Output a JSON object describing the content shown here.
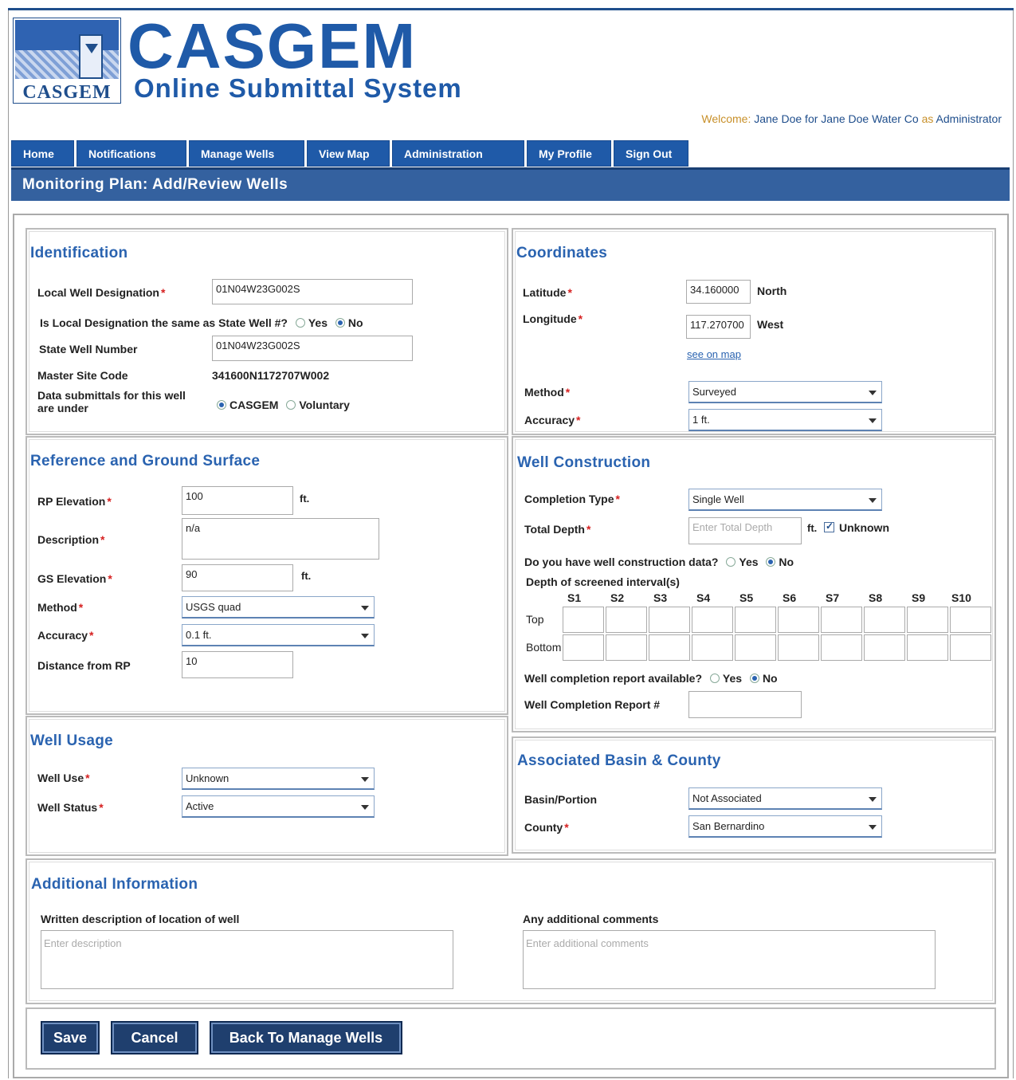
{
  "header": {
    "logo_text": "CASGEM",
    "title": "CASGEM",
    "subtitle": "Online Submittal System",
    "welcome_prefix": "Welcome:",
    "welcome_user": "Jane Doe for Jane Doe Water Co",
    "welcome_as": "as",
    "welcome_role": "Administrator"
  },
  "nav": [
    "Home",
    "Notifications",
    "Manage Wells",
    "View Map",
    "Administration",
    "My Profile",
    "Sign Out"
  ],
  "page_title": "Monitoring Plan: Add/Review Wells",
  "required_mark": "*",
  "identification": {
    "title": "Identification",
    "local_label": "Local Well Designation",
    "local_value": "01N04W23G002S",
    "same_question": "Is Local Designation the same as State Well #?",
    "yes": "Yes",
    "no": "No",
    "state_label": "State Well Number",
    "state_value": "01N04W23G002S",
    "master_label": "Master Site Code",
    "master_value": "341600N1172707W002",
    "submittals_label_1": "Data submittals for this well",
    "submittals_label_2": "are under",
    "opt_casgem": "CASGEM",
    "opt_voluntary": "Voluntary"
  },
  "coordinates": {
    "title": "Coordinates",
    "lat_label": "Latitude",
    "lat_value": "34.160000",
    "lat_dir": "North",
    "lon_label": "Longitude",
    "lon_value": "117.270700",
    "lon_dir": "West",
    "map_link": "see on map",
    "method_label": "Method",
    "method_value": "Surveyed",
    "accuracy_label": "Accuracy",
    "accuracy_value": "1 ft."
  },
  "reference": {
    "title": "Reference and Ground Surface",
    "rp_label": "RP Elevation",
    "rp_value": "100",
    "unit": "ft.",
    "desc_label": "Description",
    "desc_value": "n/a",
    "gs_label": "GS Elevation",
    "gs_value": "90",
    "method_label": "Method",
    "method_value": "USGS quad",
    "accuracy_label": "Accuracy",
    "accuracy_value": "0.1 ft.",
    "distance_label": "Distance from RP",
    "distance_value": "10"
  },
  "construction": {
    "title": "Well Construction",
    "completion_label": "Completion Type",
    "completion_value": "Single Well",
    "depth_label": "Total Depth",
    "depth_placeholder": "Enter Total Depth",
    "unit": "ft.",
    "unknown_label": "Unknown",
    "data_question": "Do you have well construction data?",
    "yes": "Yes",
    "no": "No",
    "screened_label": "Depth of screened interval(s)",
    "columns": [
      "S1",
      "S2",
      "S3",
      "S4",
      "S5",
      "S6",
      "S7",
      "S8",
      "S9",
      "S10"
    ],
    "row_top": "Top",
    "row_bottom": "Bottom",
    "report_question": "Well completion report available?",
    "report_number_label": "Well Completion Report #"
  },
  "usage": {
    "title": "Well Usage",
    "use_label": "Well Use",
    "use_value": "Unknown",
    "status_label": "Well Status",
    "status_value": "Active"
  },
  "basin": {
    "title": "Associated Basin & County",
    "basin_label": "Basin/Portion",
    "basin_value": "Not Associated",
    "county_label": "County",
    "county_value": "San Bernardino"
  },
  "additional": {
    "title": "Additional Information",
    "location_label": "Written description of location of well",
    "location_placeholder": "Enter description",
    "comments_label": "Any additional comments",
    "comments_placeholder": "Enter additional comments"
  },
  "buttons": {
    "save": "Save",
    "cancel": "Cancel",
    "back": "Back To Manage Wells"
  }
}
